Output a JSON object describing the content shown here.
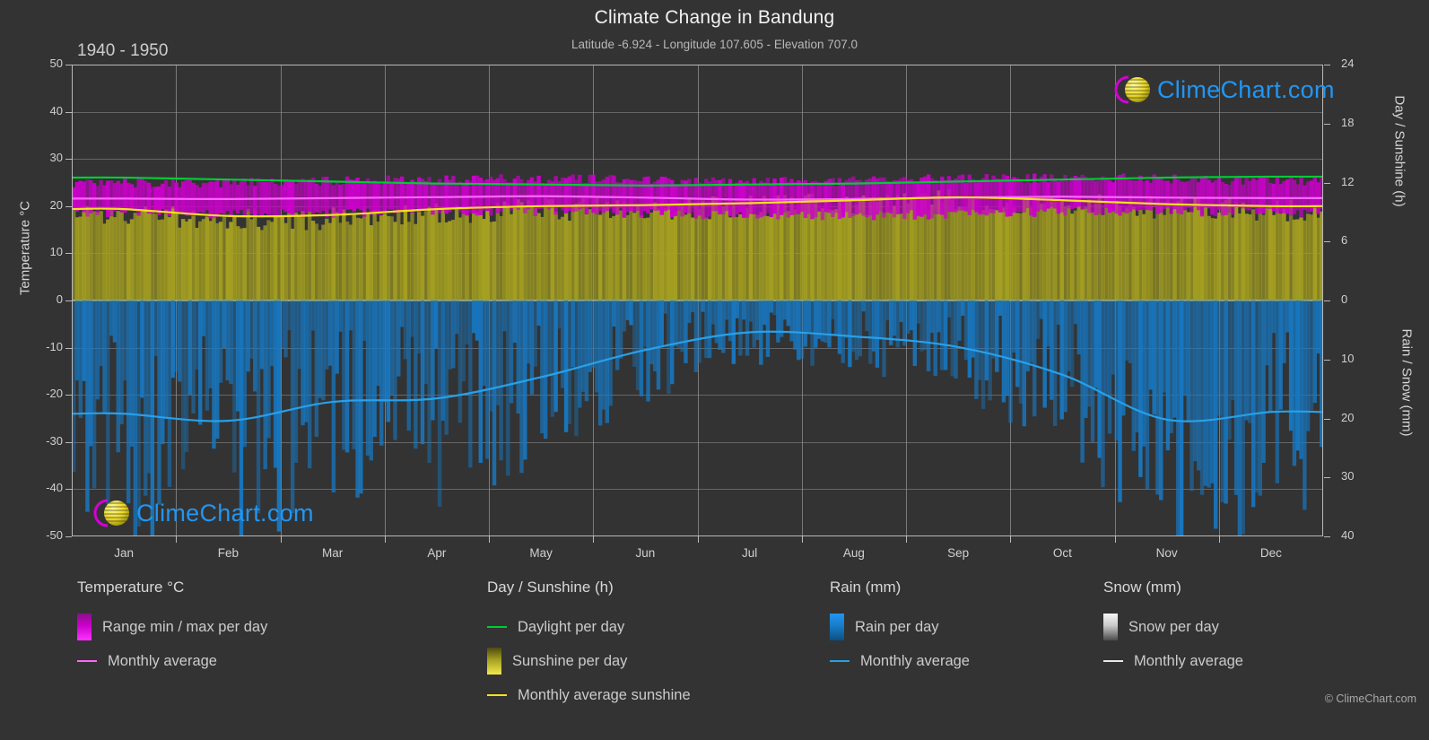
{
  "header": {
    "title": "Climate Change in Bandung",
    "subtitle": "Latitude -6.924 - Longitude 107.605 - Elevation 707.0",
    "period": "1940 - 1950"
  },
  "watermark": {
    "text": "ClimeChart.com"
  },
  "footer": {
    "credit": "© ClimeChart.com"
  },
  "legend": {
    "temperature": {
      "heading": "Temperature °C",
      "items": [
        {
          "label": "Range min / max per day",
          "marker": "gradient-magenta"
        },
        {
          "label": "Monthly average",
          "marker": "line-pink"
        }
      ]
    },
    "sunshine": {
      "heading": "Day / Sunshine (h)",
      "items": [
        {
          "label": "Daylight per day",
          "marker": "line-green"
        },
        {
          "label": "Sunshine per day",
          "marker": "gradient-yellow"
        },
        {
          "label": "Monthly average sunshine",
          "marker": "line-yellow"
        }
      ]
    },
    "rain": {
      "heading": "Rain (mm)",
      "items": [
        {
          "label": "Rain per day",
          "marker": "gradient-blue"
        },
        {
          "label": "Monthly average",
          "marker": "line-blue"
        }
      ]
    },
    "snow": {
      "heading": "Snow (mm)",
      "items": [
        {
          "label": "Snow per day",
          "marker": "gradient-white"
        },
        {
          "label": "Monthly average",
          "marker": "line-white"
        }
      ]
    }
  },
  "colors": {
    "background": "#333333",
    "temp_range": "#cc00cc",
    "temp_avg_line": "#ff66ff",
    "daylight_line": "#00cc33",
    "sunshine_fill": "#a5a021",
    "sunshine_line": "#f5e020",
    "rain_fill": "#1779c4",
    "rain_line": "#29a0e8",
    "snow_fill": "#e8e8e8",
    "snow_line": "#e8e8e8",
    "grid": "#909090",
    "text": "#cfcfcf"
  },
  "chart_data": {
    "type": "area",
    "title": "Climate Change in Bandung",
    "subtitle": "Latitude -6.924 - Longitude 107.605 - Elevation 707.0",
    "period": "1940 - 1950",
    "grid": true,
    "legend_position": "bottom",
    "x": {
      "label": "",
      "tick_labels": [
        "Jan",
        "Feb",
        "Mar",
        "Apr",
        "May",
        "Jun",
        "Jul",
        "Aug",
        "Sep",
        "Oct",
        "Nov",
        "Dec"
      ]
    },
    "y_left": {
      "label": "Temperature °C",
      "ticks": [
        50,
        40,
        30,
        20,
        10,
        0,
        -10,
        -20,
        -30,
        -40,
        -50
      ],
      "ylim": [
        -50,
        50
      ]
    },
    "y_right_top": {
      "label": "Day / Sunshine (h)",
      "ticks": [
        24,
        18,
        12,
        6,
        0
      ],
      "ylim": [
        0,
        24
      ],
      "maps_to_temperature": [
        0,
        50
      ]
    },
    "y_right_bottom": {
      "label": "Rain / Snow (mm)",
      "ticks": [
        0,
        10,
        20,
        30,
        40
      ],
      "ylim": [
        0,
        40
      ],
      "maps_to_temperature": [
        0,
        -50
      ]
    },
    "categories": [
      "Jan",
      "Feb",
      "Mar",
      "Apr",
      "May",
      "Jun",
      "Jul",
      "Aug",
      "Sep",
      "Oct",
      "Nov",
      "Dec"
    ],
    "series": [
      {
        "name": "Monthly average temperature",
        "unit": "°C",
        "axis": "left",
        "color": "#ff66ff",
        "values": [
          21.6,
          21.5,
          21.7,
          21.9,
          22.1,
          21.8,
          21.4,
          21.5,
          21.8,
          22.0,
          21.8,
          21.7
        ]
      },
      {
        "name": "Range max per day (approx. band top)",
        "unit": "°C",
        "axis": "left",
        "color": "#cc00cc",
        "values": [
          25.0,
          24.9,
          25.3,
          25.6,
          25.8,
          25.5,
          25.2,
          25.4,
          25.8,
          26.0,
          25.7,
          25.4
        ]
      },
      {
        "name": "Range min per day (approx. band bottom)",
        "unit": "°C",
        "axis": "left",
        "color": "#cc00cc",
        "values": [
          18.6,
          18.4,
          18.5,
          18.8,
          18.9,
          18.4,
          17.9,
          18.0,
          18.3,
          18.8,
          18.9,
          18.7
        ]
      },
      {
        "name": "Daylight per day",
        "unit": "h",
        "axis": "right_top",
        "color": "#00cc33",
        "values": [
          12.5,
          12.3,
          12.1,
          11.9,
          11.8,
          11.7,
          11.8,
          11.9,
          12.1,
          12.3,
          12.5,
          12.6
        ]
      },
      {
        "name": "Monthly average sunshine",
        "unit": "h",
        "axis": "right_top",
        "color": "#f5e020",
        "values": [
          9.3,
          8.6,
          8.7,
          9.3,
          9.6,
          9.7,
          9.9,
          10.2,
          10.5,
          10.2,
          9.8,
          9.6
        ]
      },
      {
        "name": "Monthly average rain",
        "unit": "mm",
        "axis": "right_bottom",
        "color": "#29a0e8",
        "values": [
          19.2,
          20.4,
          17.2,
          16.6,
          13.0,
          8.4,
          5.4,
          6.1,
          7.9,
          12.6,
          20.2,
          18.9
        ]
      },
      {
        "name": "Monthly average snow",
        "unit": "mm",
        "axis": "right_bottom",
        "color": "#e8e8e8",
        "values": [
          0,
          0,
          0,
          0,
          0,
          0,
          0,
          0,
          0,
          0,
          0,
          0
        ]
      }
    ]
  }
}
